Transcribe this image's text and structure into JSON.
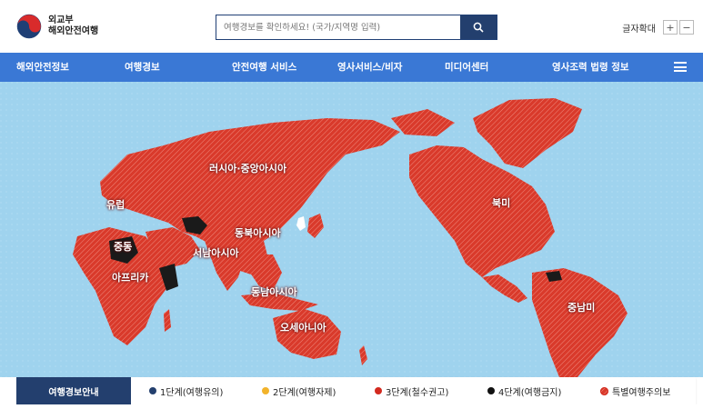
{
  "header": {
    "logo_line1": "외교부",
    "logo_line2": "해외안전여행",
    "search_placeholder": "여행경보를 확인하세요! (국가/지역명 입력)",
    "fontsize_label": "글자확대",
    "fontsize_plus": "+",
    "fontsize_minus": "−"
  },
  "nav": {
    "items": [
      "해외안전정보",
      "여행경보",
      "안전여행 서비스",
      "영사서비스/비자",
      "미디어센터",
      "영사조력 법령 정보"
    ]
  },
  "map": {
    "ocean_color": "#9fd3ee",
    "land_color": "#d93a2b",
    "regions": [
      "러시아·중앙아시아",
      "유럽",
      "중동",
      "아프리카",
      "동북아시아",
      "서남아시아",
      "동남아시아",
      "오세아니아",
      "북미",
      "중남미"
    ]
  },
  "legend": {
    "title": "여행경보안내",
    "items": [
      {
        "label": "1단계(여행유의)",
        "color": "#233f6e"
      },
      {
        "label": "2단계(여행자제)",
        "color": "#f2b32b"
      },
      {
        "label": "3단계(철수권고)",
        "color": "#d32a1f"
      },
      {
        "label": "4단계(여행금지)",
        "color": "#111111"
      },
      {
        "label": "특별여행주의보",
        "color": "#d32a1f"
      }
    ]
  }
}
